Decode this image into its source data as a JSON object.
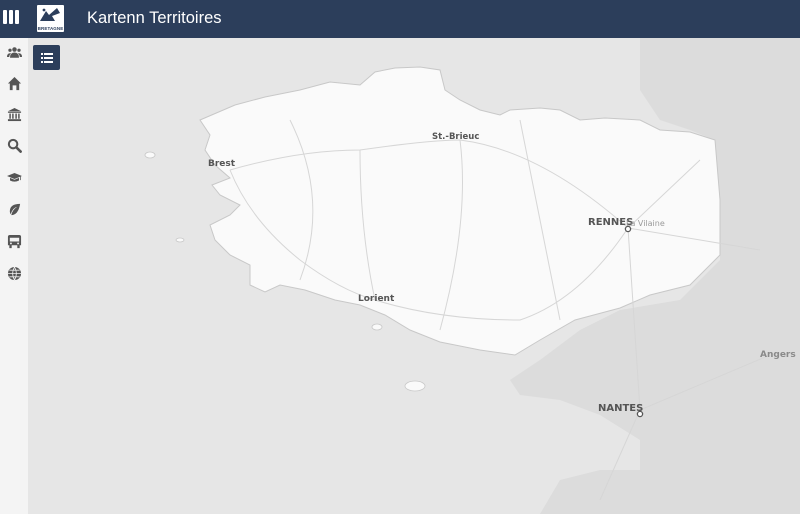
{
  "header": {
    "title": "Kartenn Territoires",
    "logo_text": "BRETAGNE"
  },
  "sidebar": {
    "items": [
      {
        "icon": "users-icon"
      },
      {
        "icon": "home-icon"
      },
      {
        "icon": "institution-icon"
      },
      {
        "icon": "search-icon"
      },
      {
        "icon": "graduation-cap-icon"
      },
      {
        "icon": "leaf-icon"
      },
      {
        "icon": "bus-icon"
      },
      {
        "icon": "globe-icon"
      }
    ]
  },
  "map": {
    "layers_button": "list-icon",
    "labels": {
      "brest": "Brest",
      "st_brieuc": "St.-Brieuc",
      "rennes": "RENNES",
      "la_vilaine": "La Vilaine",
      "lorient": "Lorient",
      "nantes": "NANTES",
      "angers": "Angers"
    }
  }
}
